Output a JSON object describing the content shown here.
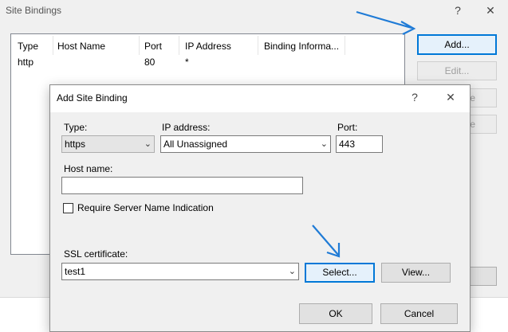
{
  "parent_window": {
    "title": "Site Bindings",
    "help_glyph": "?",
    "close_glyph": "✕",
    "columns": [
      "Type",
      "Host Name",
      "Port",
      "IP Address",
      "Binding Informa..."
    ],
    "rows": [
      {
        "type": "http",
        "host": "",
        "port": "80",
        "ip": "*",
        "info": ""
      }
    ],
    "buttons": {
      "add": "Add...",
      "edit": "Edit...",
      "remove_fragment": "e",
      "browse_fragment": "e"
    }
  },
  "dialog": {
    "title": "Add Site Binding",
    "help_glyph": "?",
    "close_glyph": "✕",
    "type_label": "Type:",
    "type_value": "https",
    "ip_label": "IP address:",
    "ip_value": "All Unassigned",
    "port_label": "Port:",
    "port_value": "443",
    "host_label": "Host name:",
    "host_value": "",
    "sni_label": "Require Server Name Indication",
    "sni_checked": false,
    "ssl_label": "SSL certificate:",
    "ssl_value": "test1",
    "select_button": "Select...",
    "view_button": "View...",
    "ok_button": "OK",
    "cancel_button": "Cancel"
  },
  "colors": {
    "accent": "#0078d7",
    "arrow": "#1f7bd6"
  },
  "icons": [
    "help-icon",
    "close-icon",
    "chevron-down-icon",
    "checkbox-icon",
    "arrow-annotation-icon"
  ]
}
